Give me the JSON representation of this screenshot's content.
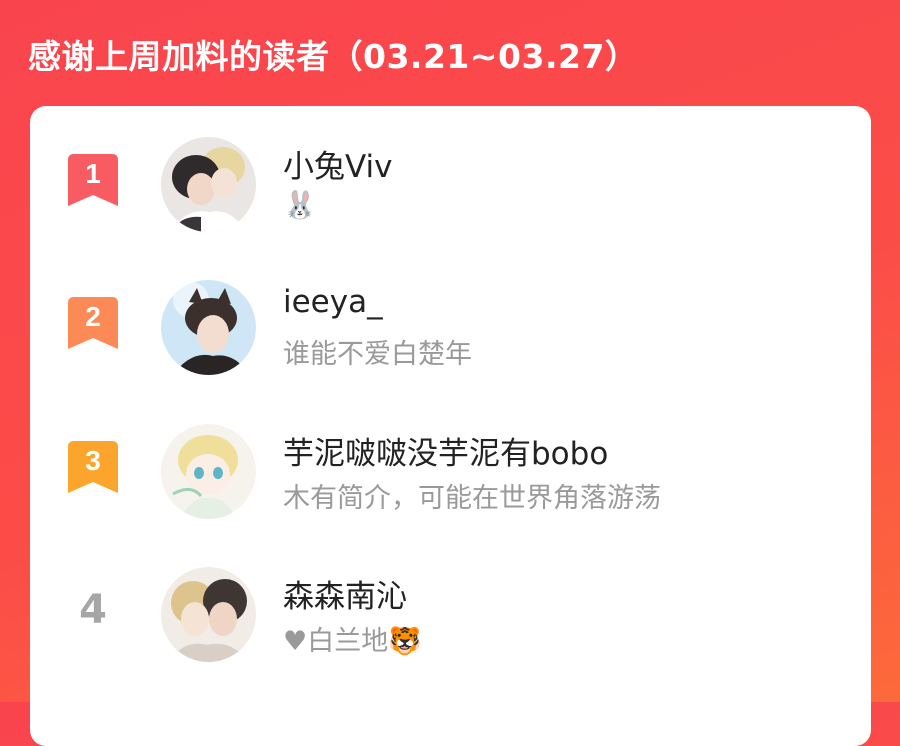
{
  "header": {
    "title": "感谢上周加料的读者（03.21~03.27）"
  },
  "readers": [
    {
      "rank": "1",
      "name": "小兔Viv",
      "bio": "🐰",
      "badge_color": "#f95b62",
      "avatar_icon": "avatar-couple-icon"
    },
    {
      "rank": "2",
      "name": "ieeya_",
      "bio": "谁能不爱白楚年",
      "badge_color": "#fb8a57",
      "avatar_icon": "avatar-catboy-icon"
    },
    {
      "rank": "3",
      "name": "芋泥啵啵没芋泥有bobo",
      "bio": "木有简介，可能在世界角落游荡",
      "badge_color": "#fca52c",
      "avatar_icon": "avatar-chibi-icon"
    },
    {
      "rank": "4",
      "name": "森森南沁",
      "bio": "♥白兰地🐯",
      "badge_color": "",
      "avatar_icon": "avatar-couple-icon"
    }
  ]
}
